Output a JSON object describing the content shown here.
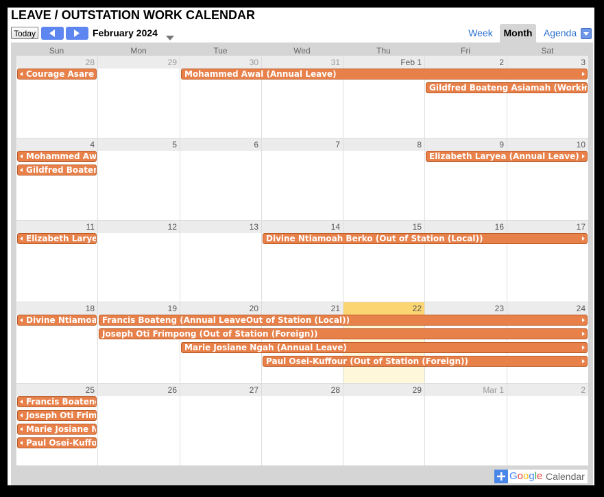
{
  "title": "LEAVE / OUTSTATION WORK CALENDAR",
  "toolbar": {
    "today_label": "Today",
    "month_label": "February 2024",
    "views": [
      "Week",
      "Month",
      "Agenda"
    ],
    "active_view": "Month"
  },
  "days_of_week": [
    "Sun",
    "Mon",
    "Tue",
    "Wed",
    "Thu",
    "Fri",
    "Sat"
  ],
  "weeks": [
    {
      "dates": [
        "28",
        "29",
        "30",
        "31",
        "Feb 1",
        "2",
        "3"
      ],
      "other_month": [
        true,
        true,
        true,
        true,
        false,
        false,
        false
      ],
      "events": [
        {
          "text": "Courage Asare (Annual Leave)",
          "start": 0,
          "span": 1,
          "row": 0,
          "left_arrow": true,
          "right_arrow": false
        },
        {
          "text": "Mohammed Awal (Annual Leave)",
          "start": 2,
          "span": 5,
          "row": 0,
          "left_arrow": false,
          "right_arrow": true
        },
        {
          "text": "Gildfred Boateng Asiamah (Working from home)",
          "start": 5,
          "span": 2,
          "row": 1,
          "left_arrow": false,
          "right_arrow": true
        }
      ]
    },
    {
      "dates": [
        "4",
        "5",
        "6",
        "7",
        "8",
        "9",
        "10"
      ],
      "other_month": [
        false,
        false,
        false,
        false,
        false,
        false,
        false
      ],
      "events": [
        {
          "text": "Mohammed Awal (Annual Leave)",
          "start": 0,
          "span": 1,
          "row": 0,
          "left_arrow": true,
          "right_arrow": false
        },
        {
          "text": "Gildfred Boateng Asiamah (Working from home)",
          "start": 0,
          "span": 1,
          "row": 1,
          "left_arrow": true,
          "right_arrow": false
        },
        {
          "text": "Elizabeth Laryea (Annual Leave)",
          "start": 5,
          "span": 2,
          "row": 0,
          "left_arrow": false,
          "right_arrow": true
        }
      ]
    },
    {
      "dates": [
        "11",
        "12",
        "13",
        "14",
        "15",
        "16",
        "17"
      ],
      "other_month": [
        false,
        false,
        false,
        false,
        false,
        false,
        false
      ],
      "events": [
        {
          "text": "Elizabeth Laryea (Annual Leave)",
          "start": 0,
          "span": 1,
          "row": 0,
          "left_arrow": true,
          "right_arrow": false
        },
        {
          "text": "Divine Ntiamoah Berko (Out of Station (Local))",
          "start": 3,
          "span": 4,
          "row": 0,
          "left_arrow": false,
          "right_arrow": true
        }
      ]
    },
    {
      "dates": [
        "18",
        "19",
        "20",
        "21",
        "22",
        "23",
        "24"
      ],
      "other_month": [
        false,
        false,
        false,
        false,
        false,
        false,
        false
      ],
      "today_index": 4,
      "events": [
        {
          "text": "Divine Ntiamoah Berko (Out of Station (Local))",
          "start": 0,
          "span": 1,
          "row": 0,
          "left_arrow": true,
          "right_arrow": false
        },
        {
          "text": "Francis Boateng (Annual LeaveOut of Station (Local))",
          "start": 1,
          "span": 6,
          "row": 0,
          "left_arrow": false,
          "right_arrow": true
        },
        {
          "text": "Joseph Oti Frimpong (Out of Station (Foreign))",
          "start": 1,
          "span": 6,
          "row": 1,
          "left_arrow": false,
          "right_arrow": true
        },
        {
          "text": "Marie Josiane Ngah (Annual Leave)",
          "start": 2,
          "span": 5,
          "row": 2,
          "left_arrow": false,
          "right_arrow": true
        },
        {
          "text": "Paul Osei-Kuffour (Out of Station (Foreign))",
          "start": 3,
          "span": 4,
          "row": 3,
          "left_arrow": false,
          "right_arrow": true
        }
      ]
    },
    {
      "dates": [
        "25",
        "26",
        "27",
        "28",
        "29",
        "Mar 1",
        "2"
      ],
      "other_month": [
        false,
        false,
        false,
        false,
        false,
        true,
        true
      ],
      "events": [
        {
          "text": "Francis Boateng (Annual LeaveOut of Station (Local))",
          "start": 0,
          "span": 1,
          "row": 0,
          "left_arrow": true,
          "right_arrow": false
        },
        {
          "text": "Joseph Oti Frimpong (Out of Station (Foreign))",
          "start": 0,
          "span": 1,
          "row": 1,
          "left_arrow": true,
          "right_arrow": false
        },
        {
          "text": "Marie Josiane Ngah (Annual Leave)",
          "start": 0,
          "span": 1,
          "row": 2,
          "left_arrow": true,
          "right_arrow": false
        },
        {
          "text": "Paul Osei-Kuffour (Out of Station (Foreign))",
          "start": 0,
          "span": 1,
          "row": 3,
          "left_arrow": true,
          "right_arrow": false
        }
      ]
    }
  ],
  "footer": {
    "google_label": "Google",
    "calendar_label": "Calendar"
  },
  "colors": {
    "event": "#e8804a",
    "event_border": "#b95a26",
    "today_header": "#fbd572",
    "today_body": "#fff7d9",
    "nav_button": "#5e86f0"
  }
}
